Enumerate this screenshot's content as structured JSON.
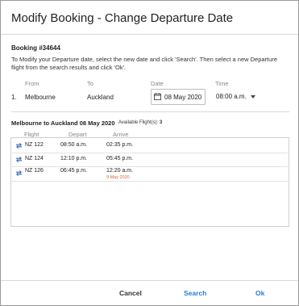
{
  "dialog": {
    "title": "Modify Booking - Change Departure Date",
    "booking_ref": "Booking #34644",
    "instructions": "To Modify your Departure date, select the new date and click 'Search'. Then select a new Departure flight from the search results and click 'Ok'."
  },
  "leg_table": {
    "headers": {
      "from": "From",
      "to": "To",
      "date": "Date",
      "time": "Time"
    },
    "row": {
      "index": "1.",
      "from": "Melbourne",
      "to": "Auckland",
      "date": "08 May 2020",
      "time": "08:00 a.m."
    }
  },
  "results": {
    "route_title": "Melbourne to Auckland 08 May 2020",
    "available_label": "Available Flight(s):",
    "available_count": "3",
    "headers": {
      "flight": "Flight",
      "depart": "Depart",
      "arrive": "Arrive"
    },
    "flights": [
      {
        "flight": "NZ 122",
        "depart": "08:50 a.m.",
        "arrive": "02:35 p.m.",
        "arrive_note": ""
      },
      {
        "flight": "NZ 124",
        "depart": "12:10 p.m.",
        "arrive": "05:45 p.m.",
        "arrive_note": ""
      },
      {
        "flight": "NZ 126",
        "depart": "06:45 p.m.",
        "arrive": "12:20 a.m.",
        "arrive_note": "9 May 2020"
      }
    ]
  },
  "footer": {
    "cancel_label": "Cancel",
    "search_label": "Search",
    "ok_label": "Ok"
  },
  "colors": {
    "link_blue": "#2a7fd4",
    "icon_blue": "#3b6fb6",
    "next_day": "#d9643a"
  },
  "icons": {
    "flight_row": "transfer-arrows-icon",
    "date": "calendar-icon",
    "time": "chevron-down-icon"
  }
}
